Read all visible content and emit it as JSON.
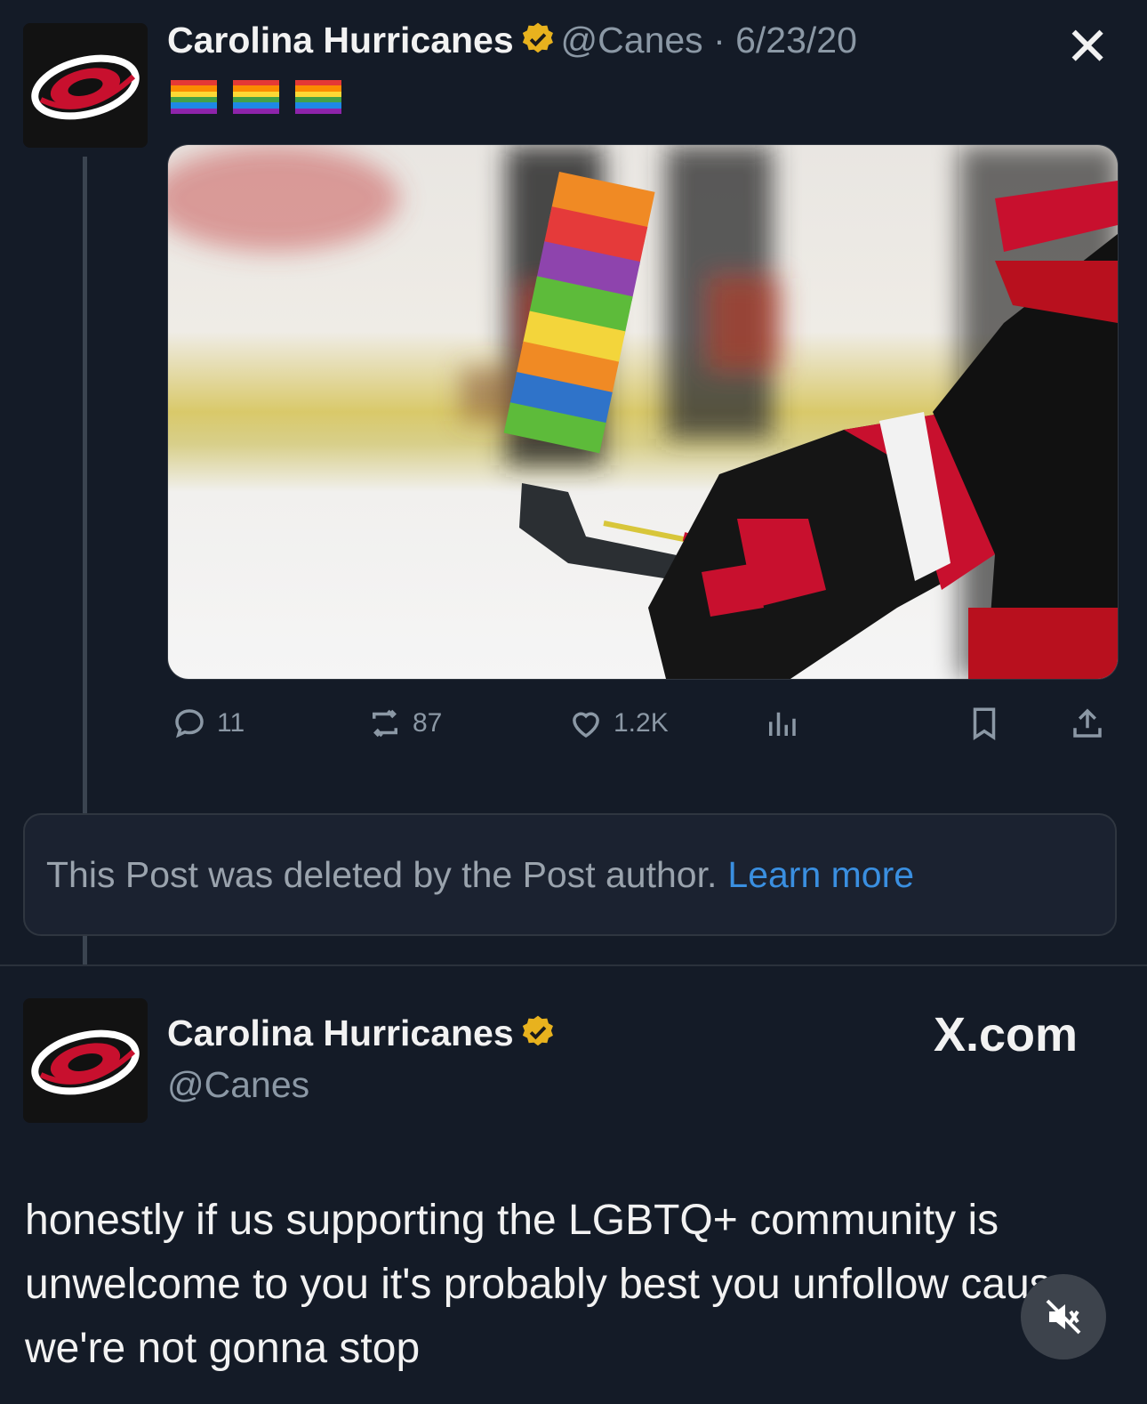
{
  "post1": {
    "author_name": "Carolina Hurricanes",
    "handle_date": "@Canes · 6/23/20",
    "close_label": "✕",
    "emoji_flags": [
      "rainbow-flag",
      "rainbow-flag",
      "rainbow-flag"
    ],
    "media_description_icon": "hockey-stick-photo",
    "actions": {
      "replies": "11",
      "reposts": "87",
      "likes": "1.2K",
      "views_icon": "bar-chart-icon",
      "bookmark_icon": "bookmark-icon",
      "share_icon": "share-icon"
    }
  },
  "deleted_notice": {
    "text": "This Post was deleted by the Post author.",
    "link": "Learn more"
  },
  "post2": {
    "author_name": "Carolina Hurricanes",
    "handle": "@Canes",
    "brand": "X.com",
    "text": "honestly if us supporting the LGBTQ+ community is unwelcome to you it's probably best you unfollow cause we're not gonna stop"
  },
  "colors": {
    "background": "#141b27",
    "link": "#3a8fe0",
    "verified_badge": "#e8b21e",
    "hurricanes_red": "#c8102e"
  }
}
